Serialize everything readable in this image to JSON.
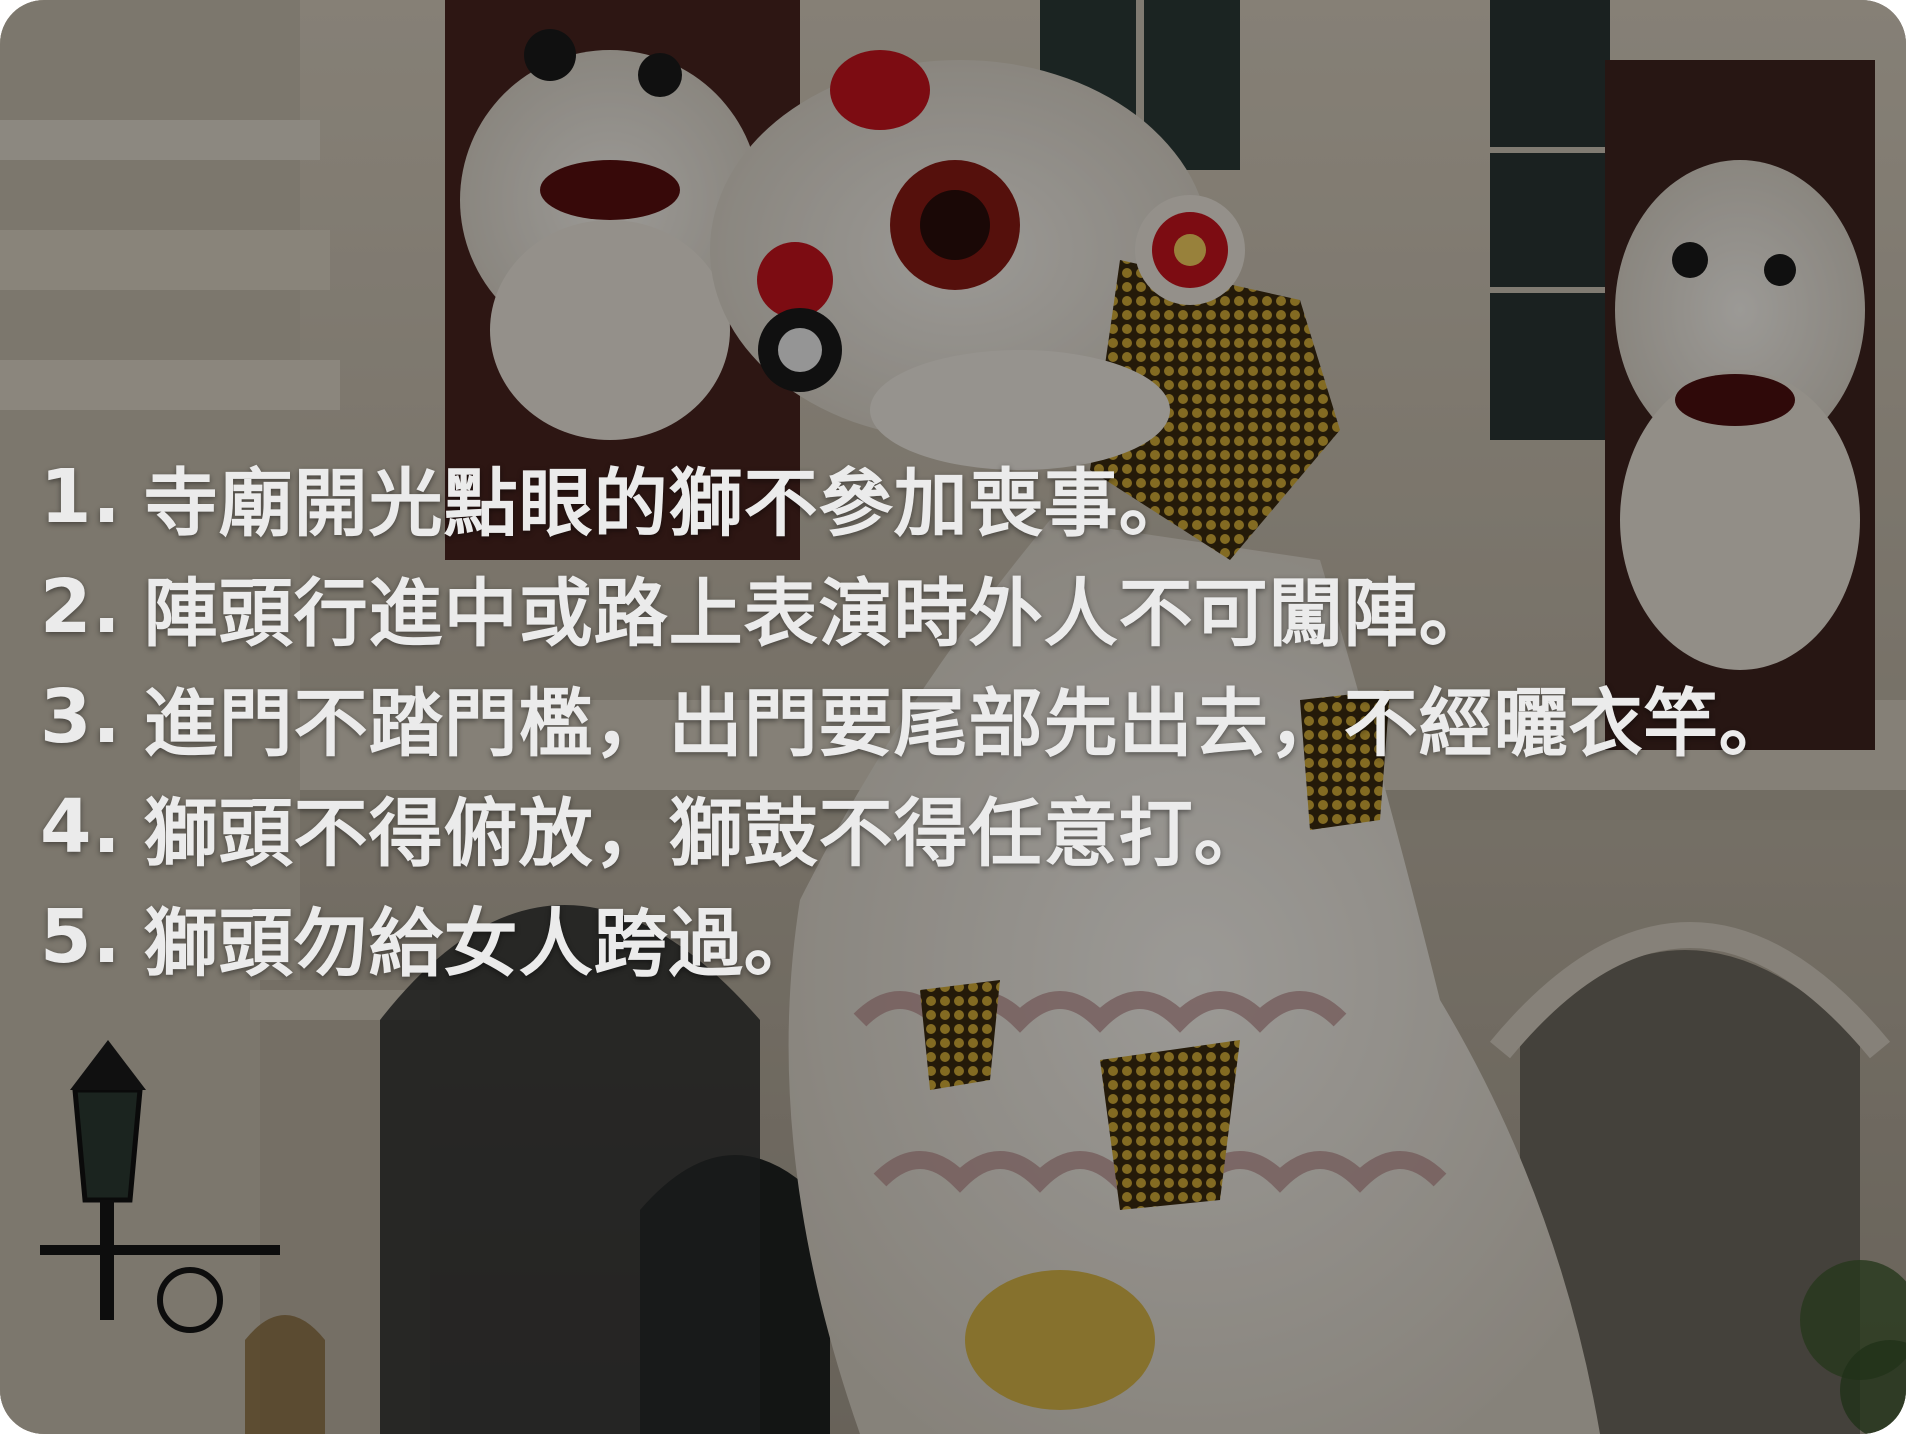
{
  "image": {
    "description_icon": "lion-dance-photo",
    "colors": {
      "overlay": "#000000",
      "text": "#ebebeb",
      "lion_red": "#c8141e",
      "lion_gold": "#c9a227",
      "fur": "#f2efe8",
      "building": "#cfc7b8"
    }
  },
  "rules": [
    {
      "number": "1.",
      "text": "寺廟開光點眼的獅不參加喪事。"
    },
    {
      "number": "2.",
      "text": "陣頭行進中或路上表演時外人不可闖陣。"
    },
    {
      "number": "3.",
      "text": "進門不踏門檻，出門要尾部先出去，不經曬衣竿。"
    },
    {
      "number": "4.",
      "text": "獅頭不得俯放，獅鼓不得任意打。"
    },
    {
      "number": "5.",
      "text": "獅頭勿給女人跨過。"
    }
  ]
}
